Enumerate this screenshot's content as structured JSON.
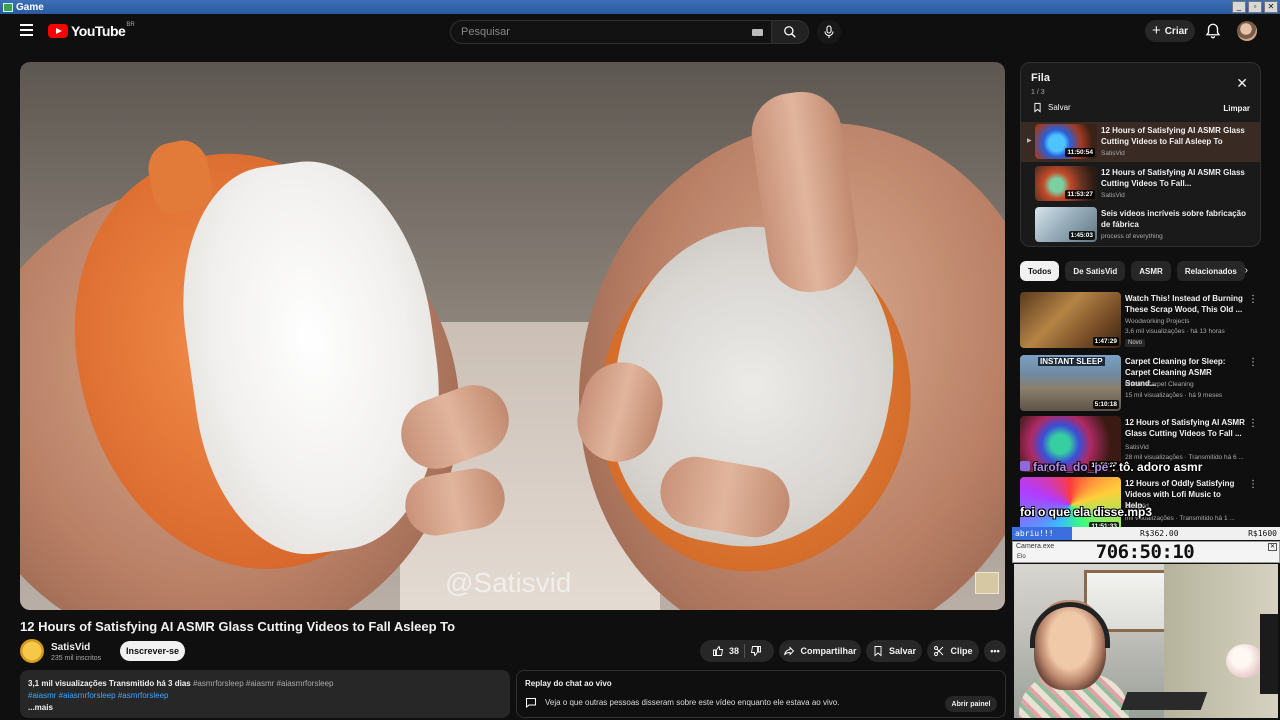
{
  "window": {
    "title": "Game"
  },
  "header": {
    "brand": "YouTube",
    "country": "BR",
    "search_placeholder": "Pesquisar",
    "create_label": "Criar"
  },
  "player": {
    "watermark": "@Satisvid"
  },
  "video": {
    "title": "12 Hours of Satisfying AI ASMR Glass Cutting Videos to Fall Asleep To",
    "channel": "SatisVid",
    "subscribers": "235 mil inscritos",
    "subscribe_label": "Inscrever-se",
    "likes": "38",
    "share_label": "Compartilhar",
    "save_label": "Salvar",
    "clip_label": "Clipe"
  },
  "description": {
    "stats": "3,1 mil visualizações  Transmitido há 3 dias",
    "tags_inline": "#asmrforsleep #aiasmr #aiasmrforsleep",
    "tags_blue": "#aiasmr #aiasmrforsleep #asmrforsleep",
    "more": "...mais"
  },
  "chat_replay": {
    "title": "Replay do chat ao vivo",
    "message": "Veja o que outras pessoas disseram sobre este vídeo enquanto ele estava ao vivo.",
    "open_label": "Abrir painel"
  },
  "queue": {
    "title": "Fila",
    "count": "1 / 3",
    "save_label": "Salvar",
    "clear_label": "Limpar",
    "items": [
      {
        "title": "12 Hours of Satisfying AI ASMR Glass Cutting Videos to Fall Asleep To",
        "channel": "SatisVid",
        "duration": "11:50:54",
        "marker": "▶"
      },
      {
        "title": "12 Hours of Satisfying AI ASMR Glass Cutting Videos To Fall...",
        "channel": "SatisVid",
        "duration": "11:53:27"
      },
      {
        "title": "Seis videos incríveis sobre fabricação de fábrica",
        "channel": "process of everything",
        "duration": "1:45:03"
      }
    ]
  },
  "chips": [
    "Todos",
    "De SatisVid",
    "ASMR",
    "Relacionados"
  ],
  "recommendations": [
    {
      "title": "Watch This! Instead of Burning These Scrap Wood, This Old ...",
      "channel": "Woodworking Projects",
      "meta": "3,6 mil visualizações · há 13 horas",
      "badge": "Novo",
      "duration": "1:47:29"
    },
    {
      "title": "Carpet Cleaning for Sleep: Carpet Cleaning ASMR Sound...",
      "channel": "Master Carpet Cleaning",
      "meta": "15 mil visualizações · há 9 meses",
      "duration": "5:10:18",
      "thumb_text": "INSTANT SLEEP"
    },
    {
      "title": "12 Hours of Satisfying AI ASMR Glass Cutting Videos To Fall ...",
      "channel": "SatisVid",
      "meta": "28 mil visualizações · Transmitido há 6 ...",
      "duration": "11:53:27"
    },
    {
      "title": "12 Hours of Oddly Satisfying Videos with Lofi Music to Help...",
      "channel": "SatisVid",
      "meta": "mil visualizações · Transmitido há 1 ...",
      "duration": "11:51:33"
    }
  ],
  "overlay_chat": {
    "line1_user": "farofa_do_pe",
    "line1_text": " : tô. adoro asmr",
    "line2": "foi o que ela disse.mp3"
  },
  "stream_overlay": {
    "split_label": "abriu!!!",
    "money1": "R$362.00",
    "money2": "R$1600",
    "window_title": "Camera.exe",
    "window_sub": "Elo",
    "timer": "706:50:10"
  }
}
